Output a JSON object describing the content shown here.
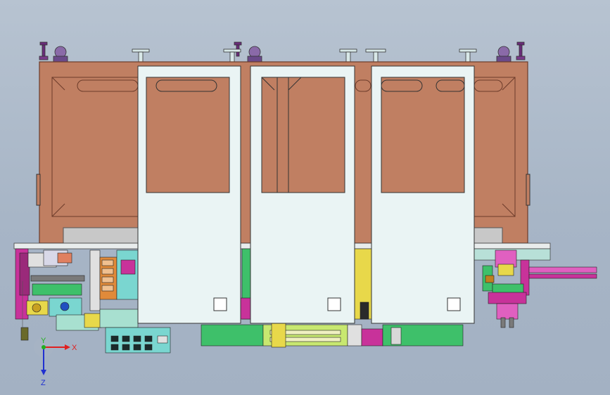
{
  "viewport": {
    "background_top": "#b7c3d1",
    "background_bottom": "#a3b1c3"
  },
  "colors": {
    "cabinet": "#c07f62",
    "cabinet_dark": "#8a4f3a",
    "door": "#eaf4f4",
    "door_window": "#c07f62",
    "frame_grey": "#c8c8c8",
    "machinery_green": "#3ec06a",
    "machinery_magenta": "#c8329a",
    "machinery_yellow": "#e8d84a",
    "machinery_cyan": "#7ad6d0",
    "machinery_orange": "#e08a3a"
  },
  "triad": {
    "x_label": "X",
    "y_label": "Y",
    "z_label": "Z",
    "x_color": "#e02020",
    "y_color": "#20b020",
    "z_color": "#2030d0"
  },
  "doors": [
    {
      "name": "door-left"
    },
    {
      "name": "door-middle"
    },
    {
      "name": "door-right"
    }
  ]
}
